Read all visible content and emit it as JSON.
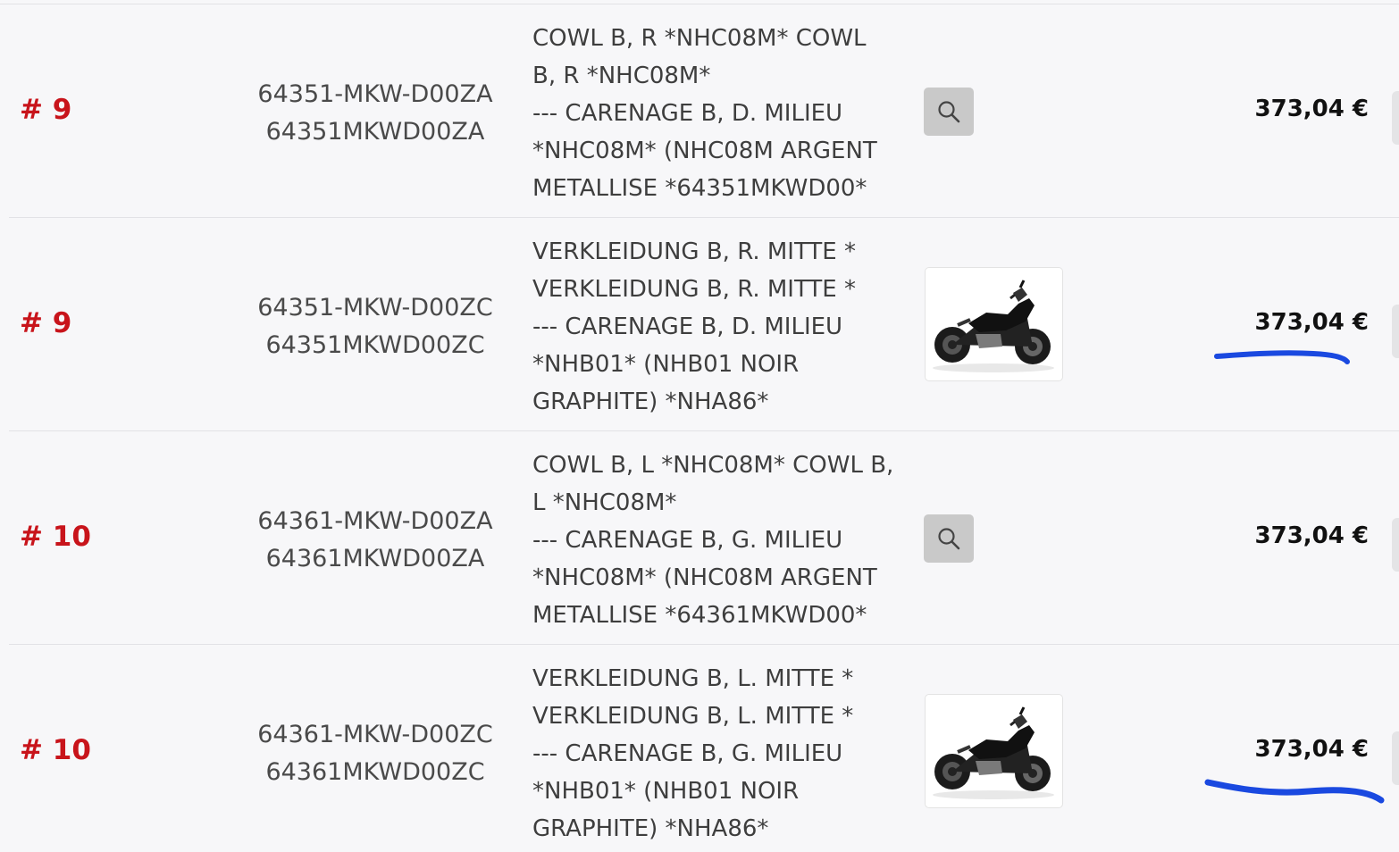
{
  "rows": [
    {
      "ref": "# 9",
      "part_number": "64351-MKW-D00ZA",
      "part_code": "64351MKWD00ZA",
      "description": [
        "COWL B, R *NHC08M* COWL",
        "B, R *NHC08M*",
        "--- CARENAGE B, D. MILIEU",
        "*NHC08M* (NHC08M ARGENT",
        "METALLISE *64351MKWD00*"
      ],
      "media": "zoom",
      "price": "373,04 €"
    },
    {
      "ref": "# 9",
      "part_number": "64351-MKW-D00ZC",
      "part_code": "64351MKWD00ZC",
      "description": [
        "VERKLEIDUNG B, R. MITTE *",
        "VERKLEIDUNG B, R. MITTE *",
        "--- CARENAGE B, D. MILIEU",
        "*NHB01* (NHB01 NOIR",
        "GRAPHITE) *NHA86*"
      ],
      "media": "thumbnail",
      "price": "373,04 €"
    },
    {
      "ref": "# 10",
      "part_number": "64361-MKW-D00ZA",
      "part_code": "64361MKWD00ZA",
      "description": [
        "COWL B, L *NHC08M* COWL B,",
        "L *NHC08M*",
        "--- CARENAGE B, G. MILIEU",
        "*NHC08M* (NHC08M ARGENT",
        "METALLISE *64361MKWD00*"
      ],
      "media": "zoom",
      "price": "373,04 €"
    },
    {
      "ref": "# 10",
      "part_number": "64361-MKW-D00ZC",
      "part_code": "64361MKWD00ZC",
      "description": [
        "VERKLEIDUNG B, L. MITTE *",
        "VERKLEIDUNG B, L. MITTE *",
        "--- CARENAGE B, G. MILIEU",
        "*NHB01* (NHB01 NOIR",
        "GRAPHITE) *NHA86*"
      ],
      "media": "thumbnail",
      "price": "373,04 €"
    }
  ],
  "icons": {
    "zoom": "magnifier-icon",
    "thumbnail": "motorcycle-thumbnail"
  },
  "colors": {
    "ref": "#c8141b",
    "annotation": "#1a49e0",
    "zoom_bg": "#c9c9c9"
  }
}
